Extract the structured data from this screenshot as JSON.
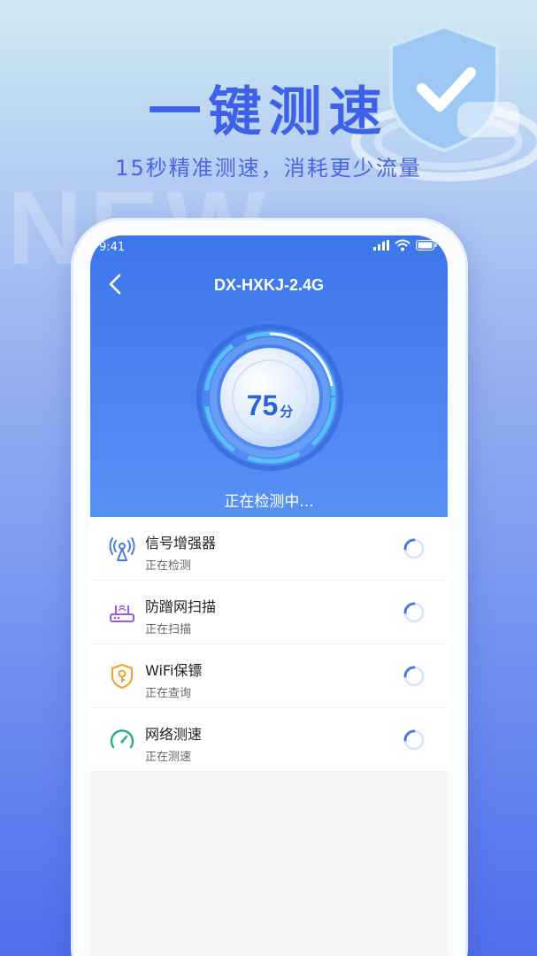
{
  "promo": {
    "headline": "一键测速",
    "subheadline": "15秒精准测速，消耗更少流量",
    "background_text": "NEW"
  },
  "status_bar": {
    "time": "9:41"
  },
  "header": {
    "title": "DX-HXKJ-2.4G"
  },
  "gauge": {
    "score": "75",
    "unit": "分",
    "status": "正在检测中..."
  },
  "items": [
    {
      "name": "信号增强器",
      "status": "正在检测",
      "icon": "signal-tower-icon"
    },
    {
      "name": "防蹭网扫描",
      "status": "正在扫描",
      "icon": "router-icon"
    },
    {
      "name": "WiFi保镖",
      "status": "正在查询",
      "icon": "shield-key-icon"
    },
    {
      "name": "网络测速",
      "status": "正在测速",
      "icon": "speedometer-icon"
    }
  ],
  "colors": {
    "accent": "#3f61e8",
    "header_blue": "#4d86f2",
    "icon_blue": "#4a7ce0",
    "icon_purple": "#9b5de0",
    "icon_orange": "#f0a132",
    "icon_green": "#27b07a"
  }
}
